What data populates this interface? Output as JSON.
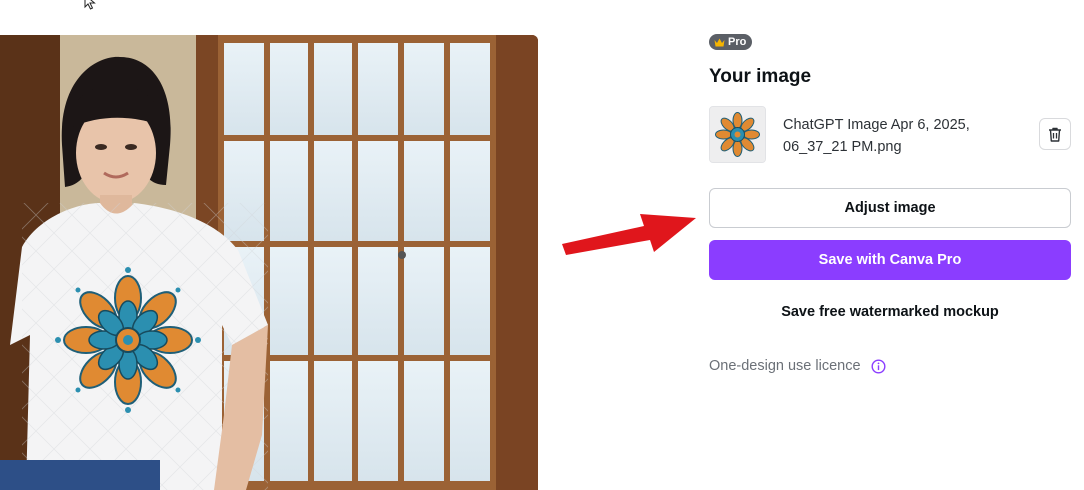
{
  "badge": {
    "label": "Pro",
    "icon": "crown-icon",
    "color": "#5b5f66",
    "icon_color": "#f5b400"
  },
  "panel": {
    "title": "Your image",
    "file_name": "ChatGPT Image Apr 6, 2025, 06_37_21 PM.png",
    "delete_icon": "trash-icon",
    "adjust_label": "Adjust image",
    "pro_label": "Save with Canva Pro",
    "free_label": "Save free watermarked mockup",
    "licence_label": "One-design use licence",
    "licence_icon": "info-icon"
  },
  "colors": {
    "accent": "#8b3dff",
    "arrow": "#e0161c"
  }
}
